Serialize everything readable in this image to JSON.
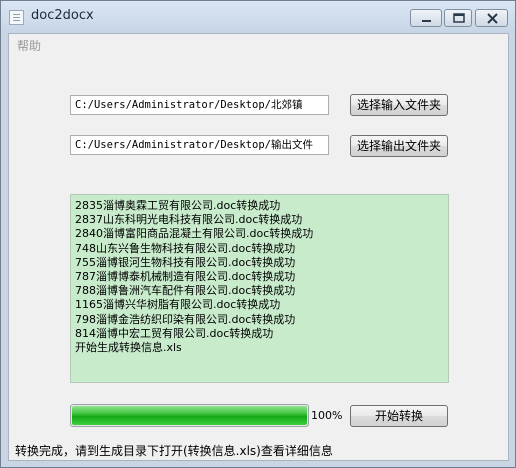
{
  "window": {
    "title": "doc2docx"
  },
  "menu": {
    "help": "帮助"
  },
  "input": {
    "input_path": "C:/Users/Administrator/Desktop/北郊镇",
    "output_path": "C:/Users/Administrator/Desktop/输出文件"
  },
  "buttons": {
    "select_input": "选择输入文件夹",
    "select_output": "选择输出文件夹",
    "start": "开始转换"
  },
  "log_lines": [
    "2835淄博奥霖工贸有限公司.doc转换成功",
    "2837山东科明光电科技有限公司.doc转换成功",
    "2840淄博富阳商品混凝土有限公司.doc转换成功",
    "748山东兴鲁生物科技有限公司.doc转换成功",
    "755淄博银河生物科技有限公司.doc转换成功",
    "787淄博博泰机械制造有限公司.doc转换成功",
    "788淄博鲁洲汽车配件有限公司.doc转换成功",
    "1165淄博兴华树脂有限公司.doc转换成功",
    "798淄博金浩纺织印染有限公司.doc转换成功",
    "814淄博中宏工贸有限公司.doc转换成功",
    "开始生成转换信息.xls"
  ],
  "progress": {
    "value": 1.0,
    "label": "100%"
  },
  "status": "转换完成，请到生成目录下打开(转换信息.xls)查看详细信息",
  "colors": {
    "log_background": "#c8ebcc",
    "progress_fill": "#14a914"
  }
}
